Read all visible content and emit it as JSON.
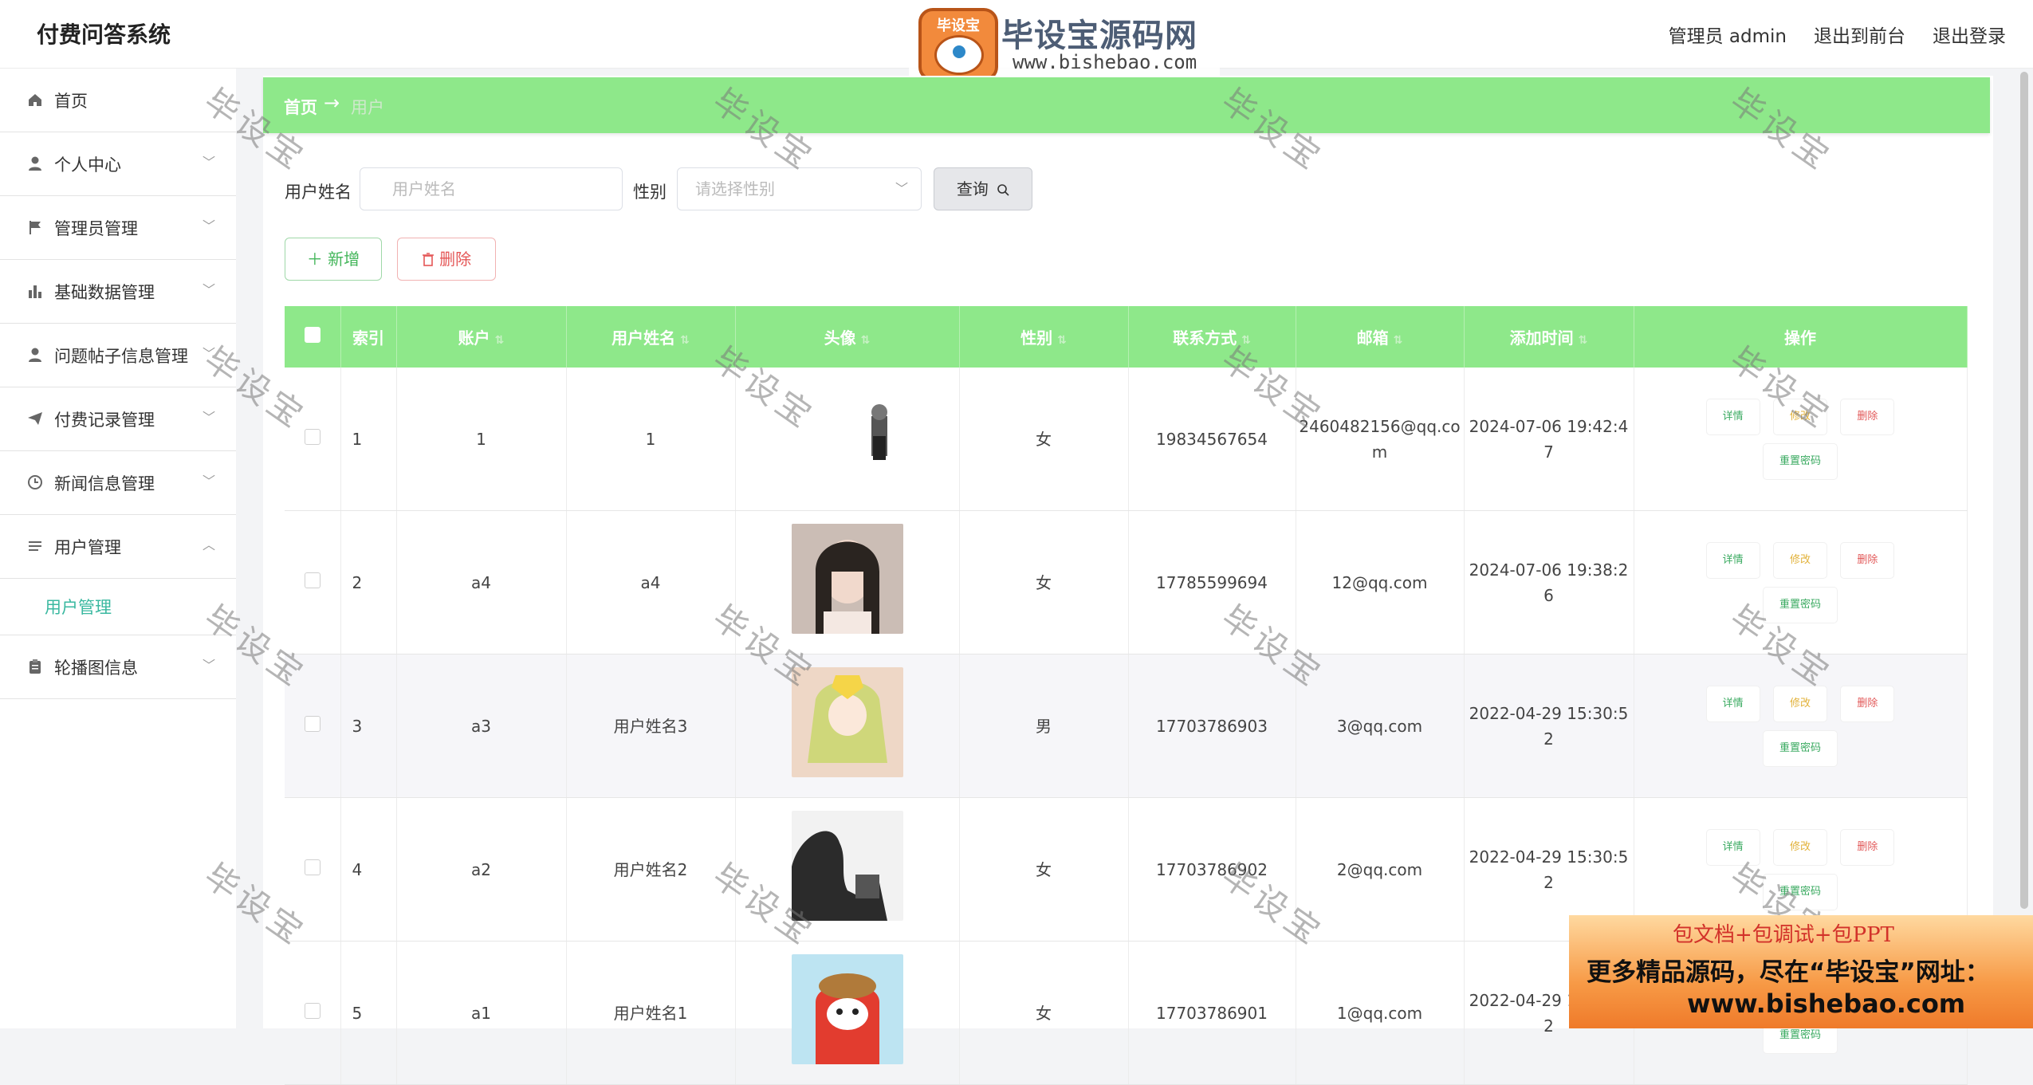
{
  "header": {
    "app_title": "付费问答系统",
    "links": [
      "管理员 admin",
      "退出到前台",
      "退出登录"
    ]
  },
  "logo": {
    "badge_text": "毕设宝",
    "name": "毕设宝源码网",
    "url": "www.bishebao.com"
  },
  "sidebar": {
    "items": [
      {
        "label": "首页",
        "icon": "home-icon"
      },
      {
        "label": "个人中心",
        "icon": "user-icon"
      },
      {
        "label": "管理员管理",
        "icon": "flag-icon"
      },
      {
        "label": "基础数据管理",
        "icon": "bar-chart-icon"
      },
      {
        "label": "问题帖子信息管理",
        "icon": "user-icon"
      },
      {
        "label": "付费记录管理",
        "icon": "send-icon"
      },
      {
        "label": "新闻信息管理",
        "icon": "clock-icon"
      },
      {
        "label": "用户管理",
        "icon": "list-icon"
      },
      {
        "label": "轮播图信息",
        "icon": "clipboard-icon"
      }
    ],
    "sub_item": "用户管理"
  },
  "breadcrumb": {
    "home": "首页",
    "arrow": "→",
    "current": "用户"
  },
  "search": {
    "name_label": "用户姓名",
    "name_placeholder": "用户姓名",
    "gender_label": "性别",
    "gender_placeholder": "请选择性别",
    "query_button": "查询"
  },
  "actions": {
    "add": "新增",
    "delete": "删除"
  },
  "table": {
    "headers": [
      "索引",
      "账户",
      "用户姓名",
      "头像",
      "性别",
      "联系方式",
      "邮箱",
      "添加时间",
      "操作"
    ],
    "rows": [
      {
        "index": "1",
        "account": "1",
        "name": "1",
        "gender": "女",
        "phone": "19834567654",
        "email": "2460482156@qq.com",
        "time": "2024-07-06 19:42:47"
      },
      {
        "index": "2",
        "account": "a4",
        "name": "a4",
        "gender": "女",
        "phone": "17785599694",
        "email": "12@qq.com",
        "time": "2024-07-06 19:38:26"
      },
      {
        "index": "3",
        "account": "a3",
        "name": "用户姓名3",
        "gender": "男",
        "phone": "17703786903",
        "email": "3@qq.com",
        "time": "2022-04-29 15:30:52"
      },
      {
        "index": "4",
        "account": "a2",
        "name": "用户姓名2",
        "gender": "女",
        "phone": "17703786902",
        "email": "2@qq.com",
        "time": "2022-04-29 15:30:52"
      },
      {
        "index": "5",
        "account": "a1",
        "name": "用户姓名1",
        "gender": "女",
        "phone": "17703786901",
        "email": "1@qq.com",
        "time": "2022-04-29 15:30:52"
      }
    ],
    "ops": {
      "detail": "详情",
      "edit": "修改",
      "remove": "删除",
      "reset": "重置密码"
    }
  },
  "watermark": "毕设宝",
  "ad": {
    "line1": "包文档+包调试+包PPT",
    "line2": "更多精品源码，尽在“毕设宝”网址：",
    "line3": "www.bishebao.com"
  },
  "colors": {
    "accent": "#8ee88a",
    "submenu_active": "#3ab8a0",
    "add": "#43b65a",
    "danger": "#e45656"
  }
}
